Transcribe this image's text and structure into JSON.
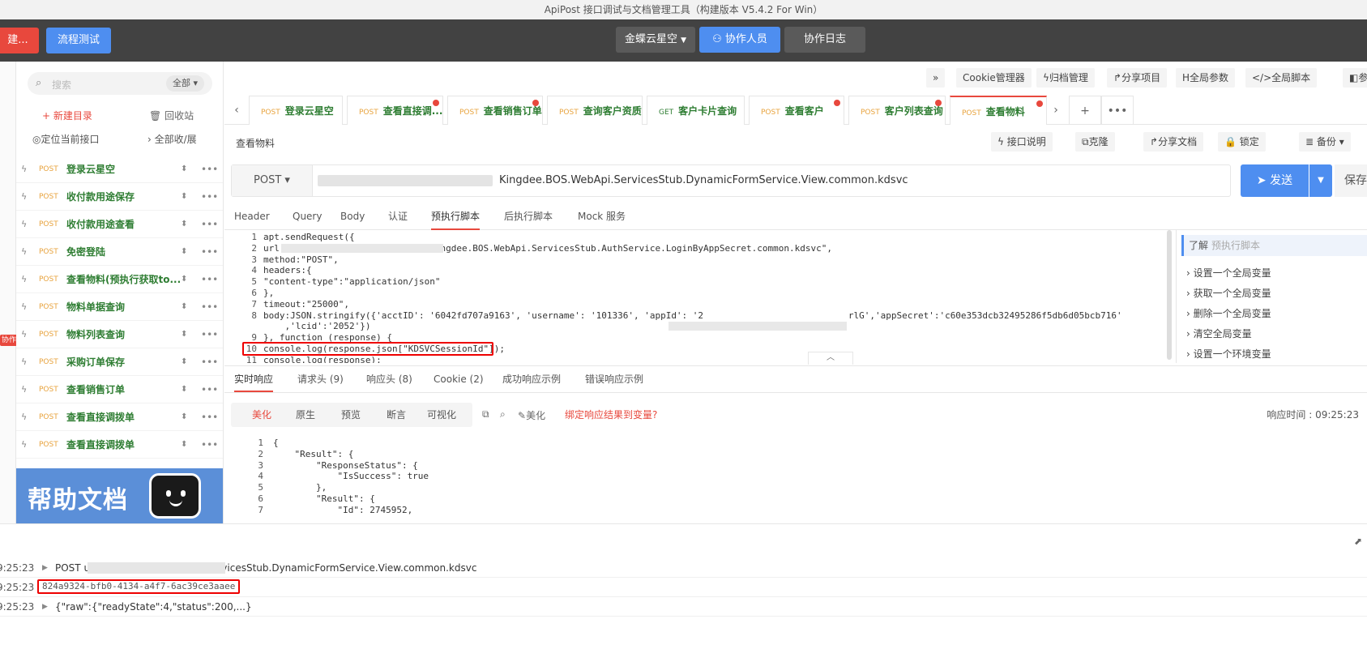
{
  "window": {
    "title": "ApiPost 接口调试与文档管理工具（构建版本 V5.4.2 For Win）"
  },
  "topbar": {
    "new_label": "建...",
    "flow_label": "流程测试",
    "project_label": "金蝶云星空",
    "collab_label": "协作人员",
    "log_label": "协作日志"
  },
  "rail": {
    "badge": "协作"
  },
  "sidebar": {
    "search_placeholder": "搜索",
    "filter_label": "全部",
    "new_dir": "+ 新建目录",
    "recycle": "回收站",
    "locate": "定位当前接口",
    "expand": "全部收/展",
    "items": [
      {
        "method": "POST",
        "name": "登录云星空"
      },
      {
        "method": "POST",
        "name": "收付款用途保存"
      },
      {
        "method": "POST",
        "name": "收付款用途查看"
      },
      {
        "method": "POST",
        "name": "免密登陆"
      },
      {
        "method": "POST",
        "name": "查看物料(预执行获取to..."
      },
      {
        "method": "POST",
        "name": "物料单据查询"
      },
      {
        "method": "POST",
        "name": "物料列表查询"
      },
      {
        "method": "POST",
        "name": "采购订单保存"
      },
      {
        "method": "POST",
        "name": "查看销售订单"
      },
      {
        "method": "POST",
        "name": "查看直接调拨单"
      },
      {
        "method": "POST",
        "name": "查看直接调拨单"
      }
    ],
    "help_banner": "帮助文档"
  },
  "toolbar": {
    "more": "»",
    "cookie": "Cookie管理器",
    "archive": "归档管理",
    "share_project": "分享项目",
    "global_params": "全局参数",
    "global_script": "全局脚本",
    "params_cut": "参"
  },
  "tabs": [
    {
      "method": "POST",
      "name": "登录云星空",
      "dot": false
    },
    {
      "method": "POST",
      "name": "查看直接调...",
      "dot": true
    },
    {
      "method": "POST",
      "name": "查看销售订单",
      "dot": true
    },
    {
      "method": "POST",
      "name": "查询客户资质",
      "dot": false
    },
    {
      "method": "GET",
      "name": "客户卡片查询",
      "dot": false
    },
    {
      "method": "POST",
      "name": "查看客户",
      "dot": true
    },
    {
      "method": "POST",
      "name": "客户列表查询",
      "dot": true
    },
    {
      "method": "POST",
      "name": "查看物料",
      "dot": true
    }
  ],
  "request": {
    "name": "查看物料",
    "doc": "接口说明",
    "clone": "克隆",
    "share_doc": "分享文档",
    "lock": "锁定",
    "backup": "备份",
    "method": "POST",
    "url": "Kingdee.BOS.WebApi.ServicesStub.DynamicFormService.View.common.kdsvc",
    "send": "发送",
    "save": "保存"
  },
  "subtabs": [
    "Header",
    "Query",
    "Body",
    "认证",
    "预执行脚本",
    "后执行脚本",
    "Mock 服务"
  ],
  "editor": {
    "lines": [
      {
        "n": "1",
        "code": "apt.sendRequest({"
      },
      {
        "n": "2",
        "code": "url:\"                          Kingdee.BOS.WebApi.ServicesStub.AuthService.LoginByAppSecret.common.kdsvc\","
      },
      {
        "n": "3",
        "code": "method:\"POST\","
      },
      {
        "n": "4",
        "code": "headers:{"
      },
      {
        "n": "5",
        "code": "\"content-type\":\"application/json\""
      },
      {
        "n": "6",
        "code": "},"
      },
      {
        "n": "7",
        "code": "timeout:\"25000\","
      },
      {
        "n": "8",
        "code": "body:JSON.stringify({'acctID': '6042fd707a9163', 'username': '101336', 'appId': '2                           rlG','appSecret':'c60e353dcb32495286f5db6d05bcb716'"
      },
      {
        "n": "",
        "code": "    ,'lcid':'2052'})"
      },
      {
        "n": "9",
        "code": "}, function (response) {"
      },
      {
        "n": "10",
        "code": "console.log(response.json[\"KDSVCSessionId\"]);"
      },
      {
        "n": "11",
        "code": "console.log(response);"
      }
    ]
  },
  "help_panel": {
    "title_a": "了解",
    "title_b": "预执行脚本",
    "items": [
      "设置一个全局变量",
      "获取一个全局变量",
      "删除一个全局变量",
      "清空全局变量",
      "设置一个环境变量"
    ]
  },
  "response": {
    "tabs": [
      "实时响应",
      "请求头 (9)",
      "响应头 (8)",
      "Cookie (2)",
      "成功响应示例",
      "错误响应示例"
    ],
    "formats": [
      "美化",
      "原生",
      "预览",
      "断言",
      "可视化"
    ],
    "beautify_label": "美化",
    "bind_var": "绑定响应结果到变量?",
    "time": "响应时间 : 09:25:23",
    "lines": [
      {
        "n": "1",
        "code": "{"
      },
      {
        "n": "2",
        "code": "    \"Result\": {"
      },
      {
        "n": "3",
        "code": "        \"ResponseStatus\": {"
      },
      {
        "n": "4",
        "code": "            \"IsSuccess\": true"
      },
      {
        "n": "5",
        "code": "        },"
      },
      {
        "n": "6",
        "code": "        \"Result\": {"
      },
      {
        "n": "7",
        "code": "            \"Id\": 2745952,"
      }
    ]
  },
  "console": {
    "rows": [
      {
        "time": "9:25:23",
        "text": "POST                               ud/Kingdee.BOS.WebApi.ServicesStub.DynamicFormService.View.common.kdsvc"
      },
      {
        "time": "9:25:23",
        "text": "824a9324-bfb0-4134-a4f7-6ac39ce3aaee"
      },
      {
        "time": "9:25:23",
        "text": "{\"raw\":{\"readyState\":4,\"status\":200,...}"
      }
    ]
  },
  "colors": {
    "accent_red": "#e8483d",
    "accent_blue": "#4e8ef0",
    "method_post": "#e8a33d",
    "name_green": "#2e7d32"
  }
}
